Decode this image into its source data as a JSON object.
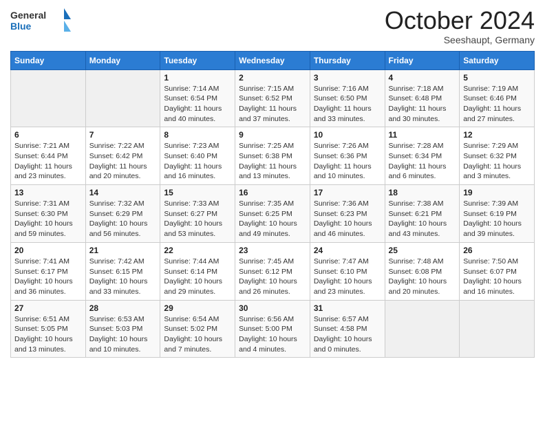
{
  "header": {
    "logo_general": "General",
    "logo_blue": "Blue",
    "month": "October 2024",
    "location": "Seeshaupt, Germany"
  },
  "days_of_week": [
    "Sunday",
    "Monday",
    "Tuesday",
    "Wednesday",
    "Thursday",
    "Friday",
    "Saturday"
  ],
  "weeks": [
    [
      {
        "day": "",
        "empty": true
      },
      {
        "day": "",
        "empty": true
      },
      {
        "day": "1",
        "sunrise": "7:14 AM",
        "sunset": "6:54 PM",
        "daylight": "11 hours and 40 minutes."
      },
      {
        "day": "2",
        "sunrise": "7:15 AM",
        "sunset": "6:52 PM",
        "daylight": "11 hours and 37 minutes."
      },
      {
        "day": "3",
        "sunrise": "7:16 AM",
        "sunset": "6:50 PM",
        "daylight": "11 hours and 33 minutes."
      },
      {
        "day": "4",
        "sunrise": "7:18 AM",
        "sunset": "6:48 PM",
        "daylight": "11 hours and 30 minutes."
      },
      {
        "day": "5",
        "sunrise": "7:19 AM",
        "sunset": "6:46 PM",
        "daylight": "11 hours and 27 minutes."
      }
    ],
    [
      {
        "day": "6",
        "sunrise": "7:21 AM",
        "sunset": "6:44 PM",
        "daylight": "11 hours and 23 minutes."
      },
      {
        "day": "7",
        "sunrise": "7:22 AM",
        "sunset": "6:42 PM",
        "daylight": "11 hours and 20 minutes."
      },
      {
        "day": "8",
        "sunrise": "7:23 AM",
        "sunset": "6:40 PM",
        "daylight": "11 hours and 16 minutes."
      },
      {
        "day": "9",
        "sunrise": "7:25 AM",
        "sunset": "6:38 PM",
        "daylight": "11 hours and 13 minutes."
      },
      {
        "day": "10",
        "sunrise": "7:26 AM",
        "sunset": "6:36 PM",
        "daylight": "11 hours and 10 minutes."
      },
      {
        "day": "11",
        "sunrise": "7:28 AM",
        "sunset": "6:34 PM",
        "daylight": "11 hours and 6 minutes."
      },
      {
        "day": "12",
        "sunrise": "7:29 AM",
        "sunset": "6:32 PM",
        "daylight": "11 hours and 3 minutes."
      }
    ],
    [
      {
        "day": "13",
        "sunrise": "7:31 AM",
        "sunset": "6:30 PM",
        "daylight": "10 hours and 59 minutes."
      },
      {
        "day": "14",
        "sunrise": "7:32 AM",
        "sunset": "6:29 PM",
        "daylight": "10 hours and 56 minutes."
      },
      {
        "day": "15",
        "sunrise": "7:33 AM",
        "sunset": "6:27 PM",
        "daylight": "10 hours and 53 minutes."
      },
      {
        "day": "16",
        "sunrise": "7:35 AM",
        "sunset": "6:25 PM",
        "daylight": "10 hours and 49 minutes."
      },
      {
        "day": "17",
        "sunrise": "7:36 AM",
        "sunset": "6:23 PM",
        "daylight": "10 hours and 46 minutes."
      },
      {
        "day": "18",
        "sunrise": "7:38 AM",
        "sunset": "6:21 PM",
        "daylight": "10 hours and 43 minutes."
      },
      {
        "day": "19",
        "sunrise": "7:39 AM",
        "sunset": "6:19 PM",
        "daylight": "10 hours and 39 minutes."
      }
    ],
    [
      {
        "day": "20",
        "sunrise": "7:41 AM",
        "sunset": "6:17 PM",
        "daylight": "10 hours and 36 minutes."
      },
      {
        "day": "21",
        "sunrise": "7:42 AM",
        "sunset": "6:15 PM",
        "daylight": "10 hours and 33 minutes."
      },
      {
        "day": "22",
        "sunrise": "7:44 AM",
        "sunset": "6:14 PM",
        "daylight": "10 hours and 29 minutes."
      },
      {
        "day": "23",
        "sunrise": "7:45 AM",
        "sunset": "6:12 PM",
        "daylight": "10 hours and 26 minutes."
      },
      {
        "day": "24",
        "sunrise": "7:47 AM",
        "sunset": "6:10 PM",
        "daylight": "10 hours and 23 minutes."
      },
      {
        "day": "25",
        "sunrise": "7:48 AM",
        "sunset": "6:08 PM",
        "daylight": "10 hours and 20 minutes."
      },
      {
        "day": "26",
        "sunrise": "7:50 AM",
        "sunset": "6:07 PM",
        "daylight": "10 hours and 16 minutes."
      }
    ],
    [
      {
        "day": "27",
        "sunrise": "6:51 AM",
        "sunset": "5:05 PM",
        "daylight": "10 hours and 13 minutes."
      },
      {
        "day": "28",
        "sunrise": "6:53 AM",
        "sunset": "5:03 PM",
        "daylight": "10 hours and 10 minutes."
      },
      {
        "day": "29",
        "sunrise": "6:54 AM",
        "sunset": "5:02 PM",
        "daylight": "10 hours and 7 minutes."
      },
      {
        "day": "30",
        "sunrise": "6:56 AM",
        "sunset": "5:00 PM",
        "daylight": "10 hours and 4 minutes."
      },
      {
        "day": "31",
        "sunrise": "6:57 AM",
        "sunset": "4:58 PM",
        "daylight": "10 hours and 0 minutes."
      },
      {
        "day": "",
        "empty": true
      },
      {
        "day": "",
        "empty": true
      }
    ]
  ]
}
